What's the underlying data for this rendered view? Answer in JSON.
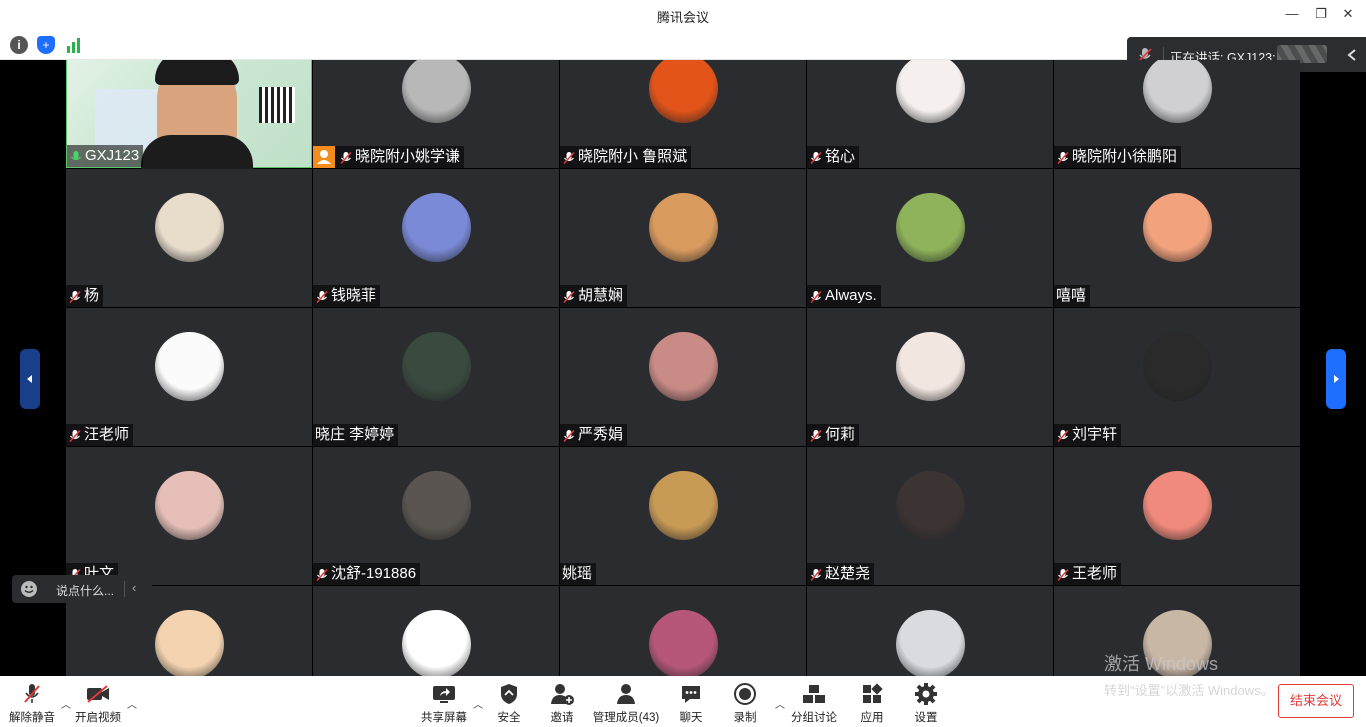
{
  "window": {
    "title": "腾讯会议"
  },
  "speaking": {
    "text": "正在讲话: GXJ123;"
  },
  "chat": {
    "placeholder": "说点什么..."
  },
  "participants": [
    {
      "name": "GXJ123",
      "mic": "on",
      "video": true
    },
    {
      "name": "晓院附小姚学谦",
      "mic": "muted",
      "badge": true
    },
    {
      "name": "晓院附小 鲁照斌",
      "mic": "muted"
    },
    {
      "name": "铭心",
      "mic": "muted"
    },
    {
      "name": "晓院附小徐鹏阳",
      "mic": "muted"
    },
    {
      "name": "杨",
      "mic": "muted"
    },
    {
      "name": "钱晓菲",
      "mic": "muted"
    },
    {
      "name": "胡慧娴",
      "mic": "muted"
    },
    {
      "name": "Always.",
      "mic": "muted"
    },
    {
      "name": "嘻嘻",
      "mic": "none"
    },
    {
      "name": "汪老师",
      "mic": "muted"
    },
    {
      "name": "晓庄  李婷婷",
      "mic": "none"
    },
    {
      "name": "严秀娟",
      "mic": "muted"
    },
    {
      "name": "何莉",
      "mic": "muted"
    },
    {
      "name": "刘宇轩",
      "mic": "muted"
    },
    {
      "name": "叶文",
      "mic": "muted"
    },
    {
      "name": "沈舒-191886",
      "mic": "muted"
    },
    {
      "name": "姚瑶",
      "mic": "none"
    },
    {
      "name": "赵楚尧",
      "mic": "muted"
    },
    {
      "name": "王老师",
      "mic": "muted"
    },
    {
      "name": "",
      "mic": "none"
    },
    {
      "name": "",
      "mic": "none"
    },
    {
      "name": "",
      "mic": "none"
    },
    {
      "name": "",
      "mic": "none"
    },
    {
      "name": "",
      "mic": "none"
    }
  ],
  "toolbar": {
    "unmute": "解除静音",
    "start_video": "开启视频",
    "share_screen": "共享屏幕",
    "security": "安全",
    "invite": "邀请",
    "manage_members": "管理成员(43)",
    "chat": "聊天",
    "record": "录制",
    "breakout": "分组讨论",
    "apps": "应用",
    "settings": "设置",
    "end_meeting": "结束会议"
  },
  "watermark": {
    "line1": "激活 Windows",
    "line2": "转到\"设置\"以激活 Windows。"
  },
  "colors": {
    "tile_bg": "#2b2c30",
    "accent_blue": "#1e6fff",
    "end_red": "#e03a3a",
    "active_speaker_border": "#5bc46b"
  },
  "avatar_colors": [
    "#d9c8a0",
    "#b8b8b8",
    "#e2541a",
    "#f5f0ee",
    "#cfcfd4",
    "#e8dccb",
    "#7a8ad6",
    "#d99a5e",
    "#8fb35a",
    "#f2a27c",
    "#fbfbfb",
    "#3a4a3f",
    "#c98b86",
    "#f2e6e0",
    "#2a2a2a",
    "#e6c0b8",
    "#5a5550",
    "#c79a55",
    "#3c3433",
    "#f08a7c",
    "#f4d4b0",
    "#ffffff",
    "#b6577a",
    "#d9dbe1",
    "#c9b7a6"
  ]
}
